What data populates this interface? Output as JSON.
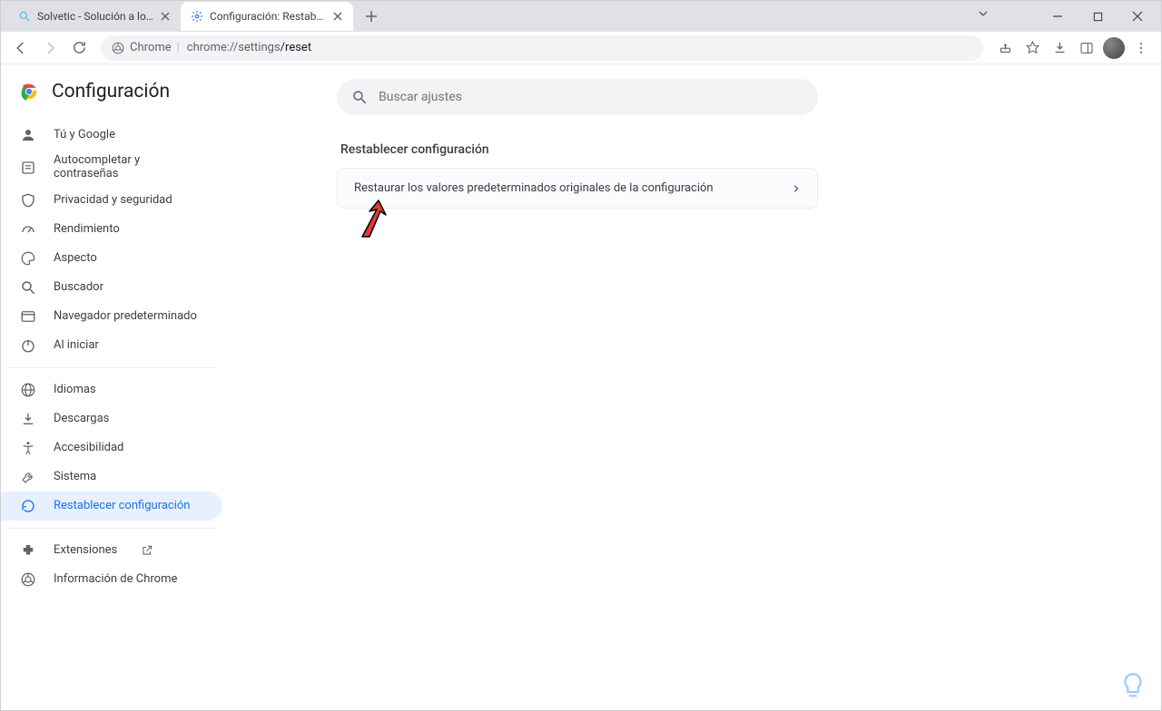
{
  "window": {
    "tabs": [
      {
        "title": "Solvetic - Solución a los problemas",
        "active": false
      },
      {
        "title": "Configuración: Restablecer configuración",
        "active": true
      }
    ]
  },
  "omnibox": {
    "scheme_label": "Chrome",
    "host": "chrome://settings",
    "path": "/reset"
  },
  "sidebar": {
    "title": "Configuración",
    "items_a": [
      {
        "label": "Tú y Google"
      },
      {
        "label": "Autocompletar y contraseñas"
      },
      {
        "label": "Privacidad y seguridad"
      },
      {
        "label": "Rendimiento"
      },
      {
        "label": "Aspecto"
      },
      {
        "label": "Buscador"
      },
      {
        "label": "Navegador predeterminado"
      },
      {
        "label": "Al iniciar"
      }
    ],
    "items_b": [
      {
        "label": "Idiomas"
      },
      {
        "label": "Descargas"
      },
      {
        "label": "Accesibilidad"
      },
      {
        "label": "Sistema"
      },
      {
        "label": "Restablecer configuración"
      }
    ],
    "items_c": [
      {
        "label": "Extensiones"
      },
      {
        "label": "Información de Chrome"
      }
    ]
  },
  "search": {
    "placeholder": "Buscar ajustes"
  },
  "section": {
    "title": "Restablecer configuración",
    "row_label": "Restaurar los valores predeterminados originales de la configuración"
  }
}
